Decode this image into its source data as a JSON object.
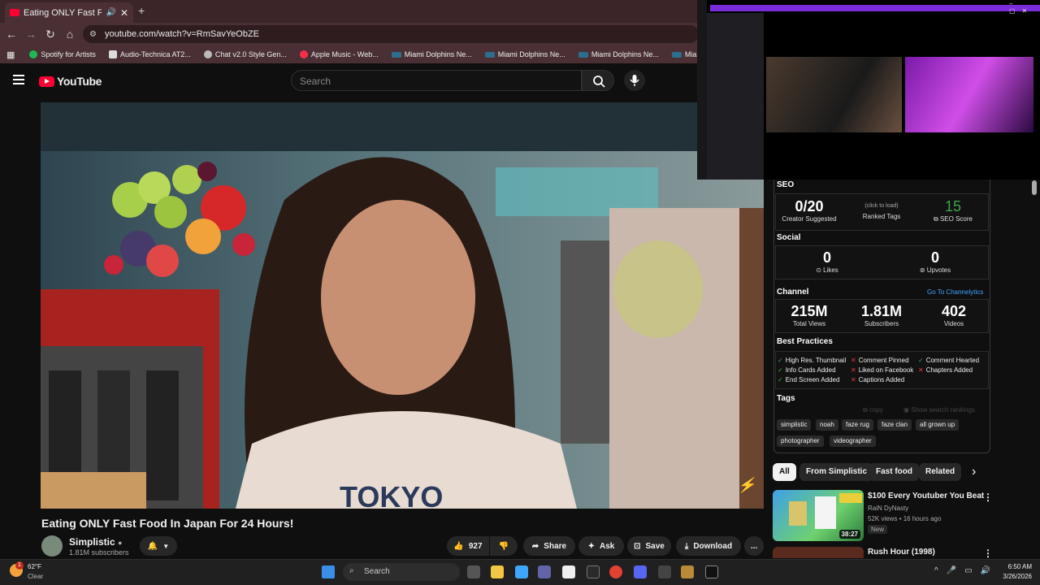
{
  "browser": {
    "tab_title": "Eating ONLY Fast Food In Ja",
    "new_tab": "+",
    "url": "youtube.com/watch?v=RmSavYeObZE",
    "bookmarks": [
      "Spotify for Artists",
      "Audio-Technica AT2...",
      "Chat v2.0 Style Gen...",
      "Apple Music - Web...",
      "Miami Dolphins Ne...",
      "Miami Dolphins Ne...",
      "Miami Dolphins Ne...",
      "Miami Dolphins Ne..."
    ]
  },
  "youtube": {
    "logo": "YouTube",
    "search_placeholder": "Search"
  },
  "video": {
    "title": "Eating ONLY Fast Food In Japan For 24 Hours!",
    "channel": "Simplistic",
    "subscribers": "1.81M subscribers",
    "likes": "927",
    "share": "Share",
    "ask": "Ask",
    "save": "Save",
    "download": "Download",
    "more": "..."
  },
  "seo_panel": {
    "seo_heading": "SEO",
    "creator_suggested_value": "0/20",
    "creator_suggested_label": "Creator Suggested",
    "ranked_tags_hint": "(click to load)",
    "ranked_tags_label": "Ranked Tags",
    "seo_score_value": "15",
    "seo_score_label": "SEO Score",
    "social_heading": "Social",
    "likes_value": "0",
    "likes_label": "Likes",
    "upvotes_value": "0",
    "upvotes_label": "Upvotes",
    "channel_heading": "Channel",
    "channel_link": "Go To Channelytics",
    "total_views_value": "215M",
    "total_views_label": "Total Views",
    "subscribers_value": "1.81M",
    "subscribers_label": "Subscribers",
    "videos_value": "402",
    "videos_label": "Videos",
    "best_practices_heading": "Best Practices",
    "best_practices": [
      "High Res. Thumbnail",
      "Comment Pinned",
      "Comment Hearted",
      "Info Cards Added",
      "Liked on Facebook",
      "Chapters Added",
      "End Screen Added",
      "Captions Added"
    ],
    "tags_heading": "Tags",
    "tags_copy": "copy",
    "tags_show_rankings": "Show search rankings",
    "tags": [
      "simplistic",
      "noah",
      "faze rug",
      "faze clan",
      "all grown up",
      "photographer",
      "videographer"
    ]
  },
  "chips": [
    "All",
    "From Simplistic",
    "Fast food",
    "Related"
  ],
  "recommendations": [
    {
      "title": "$100 Every Youtuber You Beat",
      "channel": "RaiN DyNasty",
      "meta": "52K views • 16 hours ago",
      "badge": "New",
      "duration": "38:27"
    },
    {
      "title": "Rush Hour (1998)"
    }
  ],
  "taskbar": {
    "weather_temp": "62°F",
    "weather_desc": "Clear",
    "search": "Search",
    "time": "6:50 AM",
    "date": "3/26/2026",
    "notification_count": "1"
  },
  "colors": {
    "brand_red": "#ff0033",
    "score_green": "#3ea64a",
    "link_blue": "#3ea6ff",
    "twitch_purple": "#7a2cd8"
  }
}
